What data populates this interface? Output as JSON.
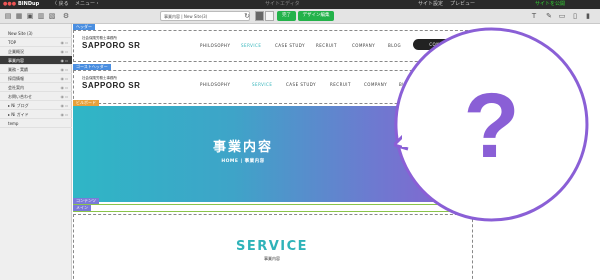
{
  "topbar": {
    "app": "BINDup",
    "back": "〈 戻る",
    "menu": "メニュー・",
    "site_name": "サイトエディタ",
    "site_settings": "サイト設定",
    "preview": "プレビュー",
    "publish": "サイトを公開"
  },
  "toolbar": {
    "url": "事業内容 | New Site(3)",
    "btn_publish": "完了",
    "btn_design": "デザイン編集"
  },
  "sidebar": {
    "items": [
      {
        "label": "New Site (3)"
      },
      {
        "label": "TOP"
      },
      {
        "label": "企業概況"
      },
      {
        "label": "事業内容"
      },
      {
        "label": "業務・実績"
      },
      {
        "label": "採用情報"
      },
      {
        "label": "会社案内"
      },
      {
        "label": "お問い合わせ"
      },
      {
        "label": "▸ Ni ブログ"
      },
      {
        "label": "▸ Ni ガイド"
      },
      {
        "label": "temp"
      }
    ]
  },
  "labels": {
    "header": "ヘッダー",
    "ghost_header": "ゴーストヘッダー",
    "billboard": "ビルボード",
    "contents": "コンテンツ",
    "main": "メイン"
  },
  "header": {
    "company": "社会保険労務士事務所",
    "logo": "SAPPORO SR",
    "nav": [
      "PHILOSOPHY",
      "SERVICE",
      "CASE STUDY",
      "RECRUIT",
      "COMPANY",
      "BLOG"
    ],
    "contact": "CONTACT"
  },
  "ghost_header": {
    "company": "社会保険労務士事務所",
    "logo": "SAPPORO SR",
    "nav": [
      "PHILOSOPHY",
      "SERVICE",
      "CASE STUDY",
      "RECRUIT",
      "COMPANY",
      "BLOG"
    ]
  },
  "hero": {
    "title": "事業内容",
    "crumb_home": "HOME",
    "crumb_sep": "|",
    "crumb_current": "事業内容"
  },
  "section": {
    "title": "SERVICE",
    "subtitle": "事業内容"
  },
  "bubble": {
    "glyph": "?",
    "color": "#8a5fd6"
  }
}
